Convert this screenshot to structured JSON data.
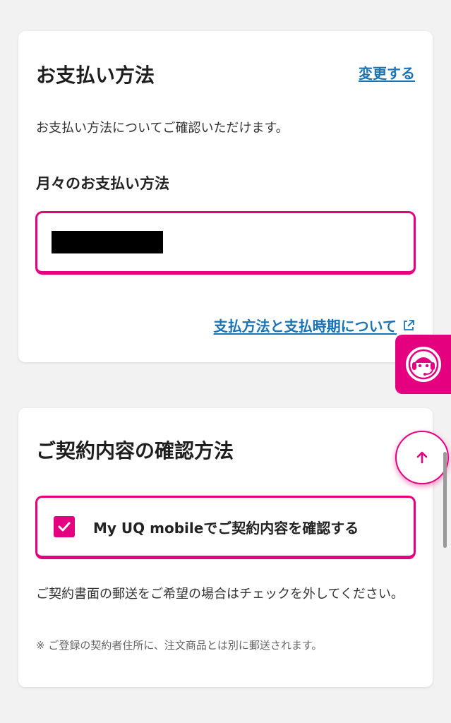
{
  "payment": {
    "title": "お支払い方法",
    "change_link": "変更する",
    "description": "お支払い方法についてご確認いただけます。",
    "monthly_title": "月々のお支払い方法",
    "info_link": "支払方法と支払時期について"
  },
  "contract": {
    "title": "ご契約内容の確認方法",
    "checkbox_label": "My UQ mobileでご契約内容を確認する",
    "checkbox_checked": true,
    "description": "ご契約書面の郵送をご希望の場合はチェックを外してください。",
    "note": "※ ご登録の契約者住所に、注文商品とは別に郵送されます。"
  },
  "icons": {
    "external": "external-link-icon",
    "support": "support-headset-icon",
    "back_to_top": "arrow-up-icon",
    "check": "checkmark-icon"
  },
  "colors": {
    "accent": "#e4007f",
    "link": "#1a73b5",
    "background": "#f2f2f2",
    "card": "#ffffff"
  }
}
